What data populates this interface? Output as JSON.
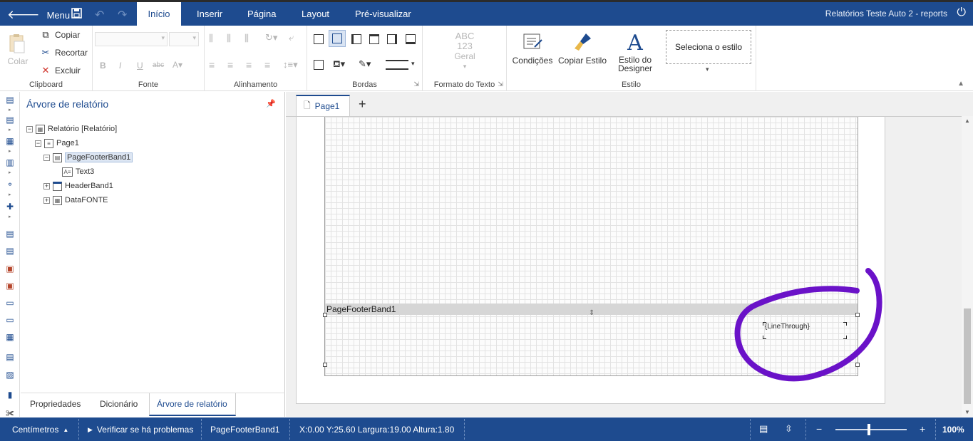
{
  "topbar": {
    "menu_label": "Menu",
    "tabs": [
      {
        "label": "Início",
        "active": true
      },
      {
        "label": "Inserir"
      },
      {
        "label": "Página"
      },
      {
        "label": "Layout"
      },
      {
        "label": "Pré-visualizar"
      }
    ],
    "title": "Relatórios Teste Auto 2 - reports"
  },
  "ribbon": {
    "clipboard": {
      "paste": "Colar",
      "copy": "Copiar",
      "cut": "Recortar",
      "delete": "Excluir",
      "label": "Clipboard"
    },
    "font": {
      "label": "Fonte",
      "bold": "B",
      "italic": "I",
      "underline": "U",
      "strike": "abc"
    },
    "alignment": {
      "label": "Alinhamento"
    },
    "borders": {
      "label": "Bordas"
    },
    "text_format": {
      "sample_top": "ABC",
      "sample_mid": "123",
      "general": "Geral",
      "label": "Formato do Texto"
    },
    "style": {
      "conditions": "Condições",
      "copy_style": "Copiar Estilo",
      "designer_style_1": "Estilo do",
      "designer_style_2": "Designer",
      "select_style": "Seleciona o estilo",
      "label": "Estilo"
    }
  },
  "panel": {
    "title": "Árvore de relatório",
    "tree": [
      {
        "label": "Relatório [Relatório]"
      },
      {
        "label": "Page1"
      },
      {
        "label": "PageFooterBand1"
      },
      {
        "label": "Text3"
      },
      {
        "label": "HeaderBand1"
      },
      {
        "label": "DataFONTE"
      }
    ],
    "tabs": [
      {
        "label": "Propriedades"
      },
      {
        "label": "Dicionário"
      },
      {
        "label": "Árvore de relatório",
        "active": true
      }
    ]
  },
  "designer": {
    "page_tab": "Page1",
    "band_name": "PageFooterBand1",
    "text_component": "{LineThrough}"
  },
  "statusbar": {
    "units": "Centímetros",
    "check": "Verificar se há problemas",
    "selected": "PageFooterBand1",
    "position": "X:0.00 Y:25.60 Largura:19.00 Altura:1.80",
    "zoom_minus": "−",
    "zoom_plus": "+",
    "zoom": "100%"
  },
  "colors": {
    "brand": "#1e4b8f",
    "annotation": "#6a12c8"
  }
}
